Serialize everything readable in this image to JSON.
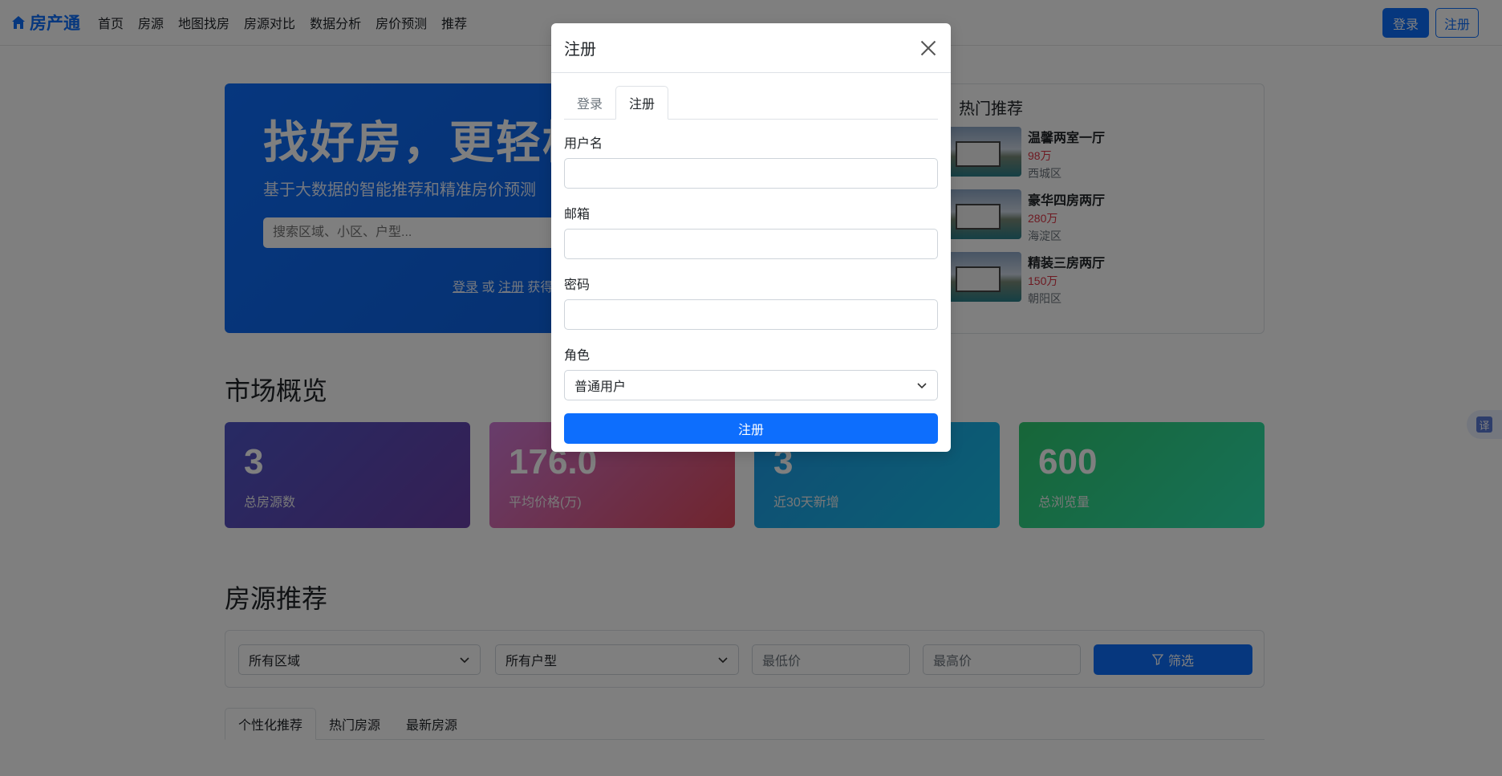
{
  "navbar": {
    "brand": "房产通",
    "links": [
      "首页",
      "房源",
      "地图找房",
      "房源对比",
      "数据分析",
      "房价预测",
      "推荐"
    ],
    "login_label": "登录",
    "register_label": "注册"
  },
  "hero": {
    "title": "找好房，更轻松",
    "subtitle": "基于大数据的智能推荐和精准房价预测",
    "search_placeholder": "搜索区域、小区、户型...",
    "hint_login": "登录",
    "hint_or": "或",
    "hint_register": "注册",
    "hint_rest": "获得"
  },
  "hot": {
    "title": "热门推荐",
    "items": [
      {
        "title": "温馨两室一厅",
        "price": "98万",
        "area": "西城区"
      },
      {
        "title": "豪华四房两厅",
        "price": "280万",
        "area": "海淀区"
      },
      {
        "title": "精装三房两厅",
        "price": "150万",
        "area": "朝阳区"
      }
    ]
  },
  "market": {
    "title": "市场概览",
    "stats": [
      {
        "value": "3",
        "label": "总房源数"
      },
      {
        "value": "176.0",
        "label": "平均价格(万)"
      },
      {
        "value": "3",
        "label": "近30天新增"
      },
      {
        "value": "600",
        "label": "总浏览量"
      }
    ]
  },
  "listings": {
    "title": "房源推荐",
    "filter": {
      "area_selected": "所有区域",
      "type_selected": "所有户型",
      "min_price_placeholder": "最低价",
      "max_price_placeholder": "最高价",
      "button_label": "筛选"
    },
    "tabs": [
      "个性化推荐",
      "热门房源",
      "最新房源"
    ]
  },
  "modal": {
    "title": "注册",
    "tabs": [
      "登录",
      "注册"
    ],
    "username_label": "用户名",
    "username_value": "",
    "email_label": "邮箱",
    "email_value": "",
    "password_label": "密码",
    "password_value": "",
    "role_label": "角色",
    "role_selected": "普通用户",
    "submit_label": "注册"
  },
  "translate_badge": "译",
  "colors": {
    "primary": "#0d6efd",
    "danger": "#dc3545"
  }
}
